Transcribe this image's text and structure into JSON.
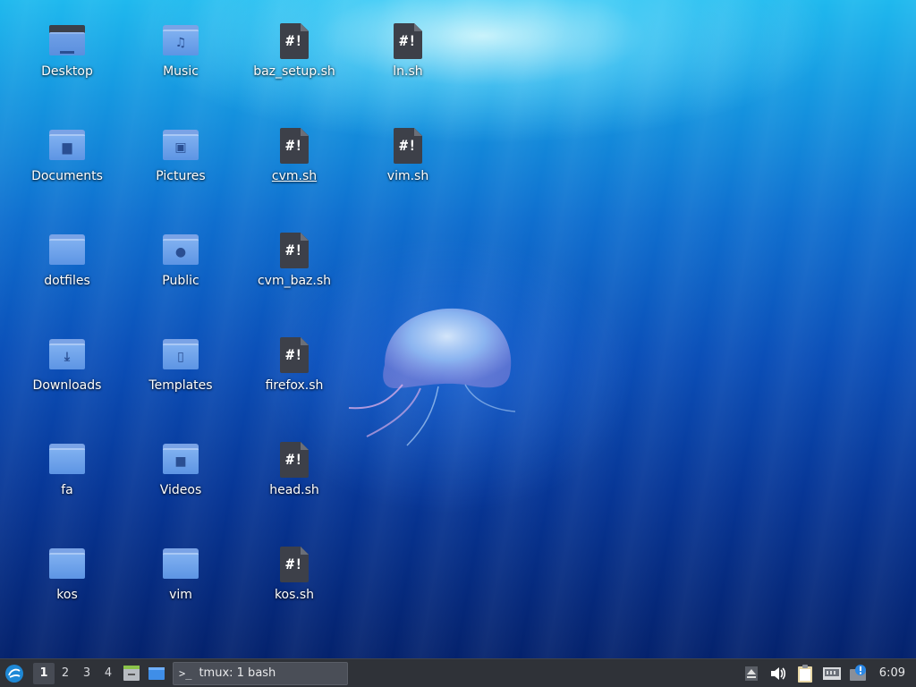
{
  "desktop": {
    "icons": [
      {
        "label": "Desktop",
        "type": "folder-desktop",
        "icon": "desktop-folder-icon"
      },
      {
        "label": "Music",
        "type": "folder",
        "glyph": "♫",
        "icon": "music-folder-icon"
      },
      {
        "label": "baz_setup.sh",
        "type": "script",
        "icon": "shell-script-icon"
      },
      {
        "label": "ln.sh",
        "type": "script",
        "icon": "shell-script-icon"
      },
      {
        "label": "Documents",
        "type": "folder",
        "glyph": "▆",
        "icon": "documents-folder-icon"
      },
      {
        "label": "Pictures",
        "type": "folder",
        "glyph": "▣",
        "icon": "pictures-folder-icon"
      },
      {
        "label": "cvm.sh",
        "type": "script",
        "icon": "shell-script-icon"
      },
      {
        "label": "vim.sh",
        "type": "script",
        "icon": "shell-script-icon"
      },
      {
        "label": "dotfiles",
        "type": "folder",
        "glyph": "",
        "icon": "folder-icon"
      },
      {
        "label": "Public",
        "type": "folder",
        "glyph": "●",
        "icon": "public-folder-icon"
      },
      {
        "label": "cvm_baz.sh",
        "type": "script",
        "icon": "shell-script-icon"
      },
      {
        "label": "Downloads",
        "type": "folder",
        "glyph": "⤓",
        "icon": "downloads-folder-icon"
      },
      {
        "label": "Templates",
        "type": "folder",
        "glyph": "▯",
        "icon": "templates-folder-icon"
      },
      {
        "label": "firefox.sh",
        "type": "script",
        "icon": "shell-script-icon"
      },
      {
        "label": "fa",
        "type": "folder",
        "glyph": "",
        "icon": "folder-icon"
      },
      {
        "label": "Videos",
        "type": "folder",
        "glyph": "■",
        "icon": "videos-folder-icon"
      },
      {
        "label": "head.sh",
        "type": "script",
        "icon": "shell-script-icon"
      },
      {
        "label": "kos",
        "type": "folder",
        "glyph": "",
        "icon": "folder-icon"
      },
      {
        "label": "vim",
        "type": "folder",
        "glyph": "",
        "icon": "folder-icon"
      },
      {
        "label": "kos.sh",
        "type": "script",
        "icon": "shell-script-icon"
      }
    ],
    "script_mark": "#!"
  },
  "taskbar": {
    "workspaces": [
      "1",
      "2",
      "3",
      "4"
    ],
    "active_workspace": "1",
    "task_terminal_glyph": ">_",
    "task_label": "tmux: 1 bash",
    "clock": "6:09"
  },
  "colors": {
    "taskbar_bg": "#2f3238",
    "folder_blue": "#6a9ee8",
    "script_dark": "#3d4049"
  }
}
